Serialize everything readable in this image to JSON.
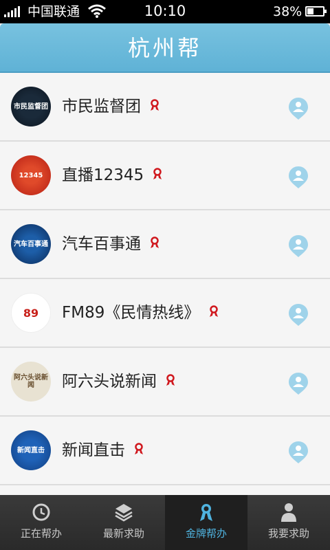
{
  "status_bar": {
    "carrier": "中国联通",
    "time": "10:10",
    "battery": "38%"
  },
  "header": {
    "title": "杭州帮"
  },
  "list": {
    "items": [
      {
        "name": "市民监督团",
        "logo_text": "市民监督团"
      },
      {
        "name": "直播12345",
        "logo_text": "12345"
      },
      {
        "name": "汽车百事通",
        "logo_text": "汽车百事通"
      },
      {
        "name": "FM89《民情热线》",
        "logo_text": "89"
      },
      {
        "name": "阿六头说新闻",
        "logo_text": "阿六头说新闻"
      },
      {
        "name": "新闻直击",
        "logo_text": "新闻直击"
      }
    ]
  },
  "tabbar": {
    "tabs": [
      {
        "label": "正在帮办",
        "icon": "clock-icon",
        "active": false
      },
      {
        "label": "最新求助",
        "icon": "layers-icon",
        "active": false
      },
      {
        "label": "金牌帮办",
        "icon": "medal-icon",
        "active": true
      },
      {
        "label": "我要求助",
        "icon": "person-icon",
        "active": false
      }
    ]
  },
  "colors": {
    "header": "#5fb2d6",
    "accent": "#4fb3df",
    "ribbon": "#d0181e",
    "tabbar": "#2a2a2a"
  }
}
